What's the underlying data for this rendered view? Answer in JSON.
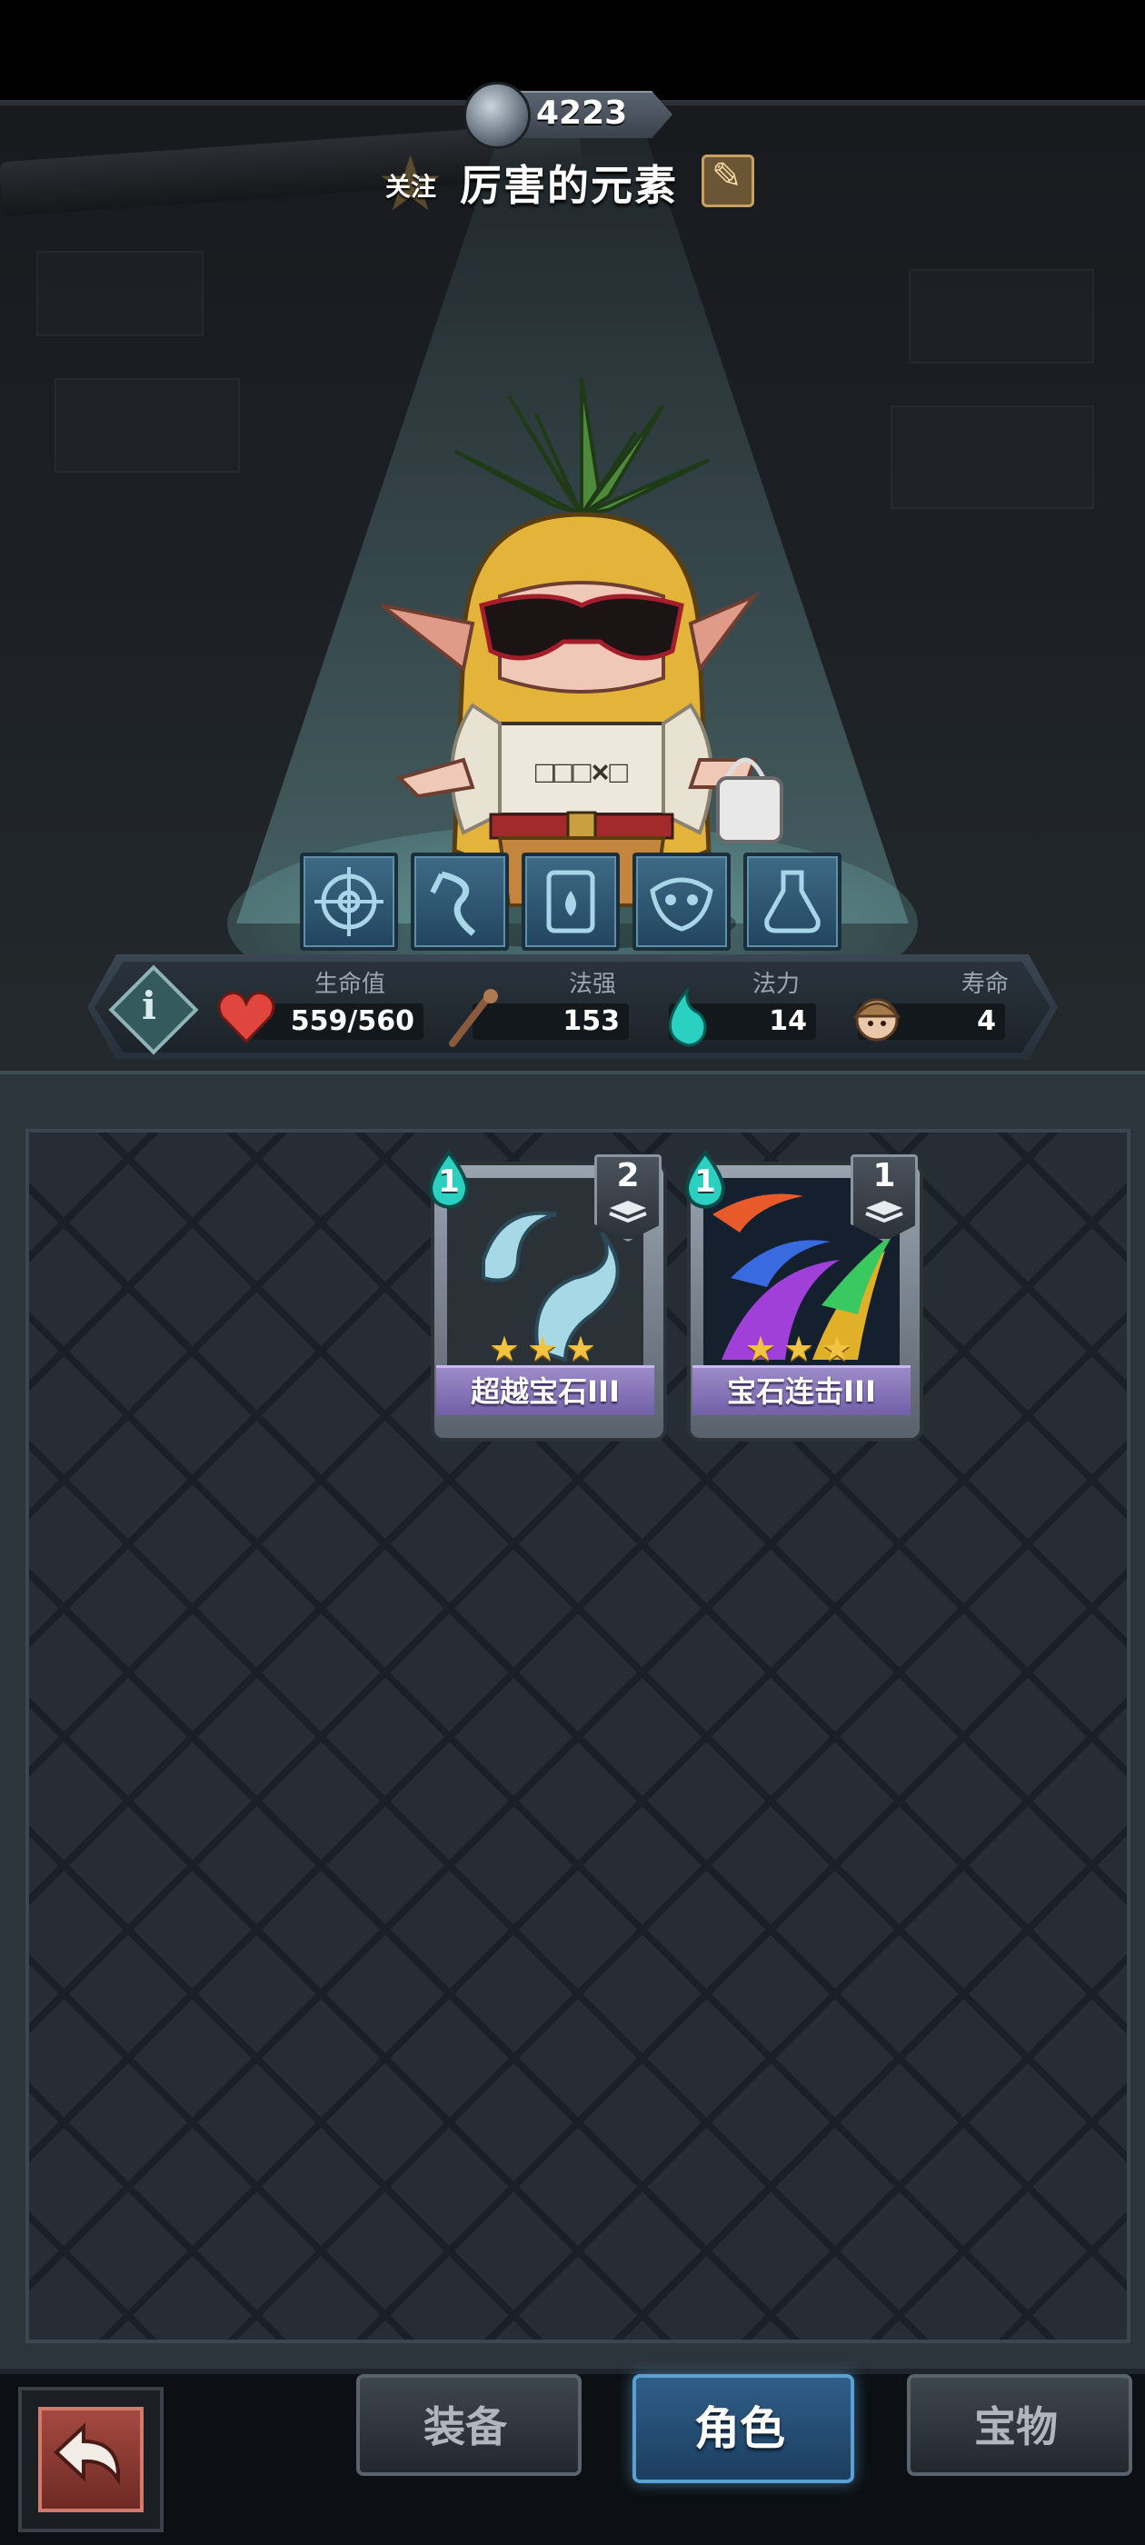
{
  "hero": {
    "power": "4223",
    "follow_label": "关注",
    "name": "厉害的元素"
  },
  "skills": [
    {
      "icon": "target-rune-icon"
    },
    {
      "icon": "claw-rune-icon"
    },
    {
      "icon": "flame-scroll-icon"
    },
    {
      "icon": "demon-mask-icon"
    },
    {
      "icon": "potion-flask-icon"
    }
  ],
  "stats": [
    {
      "label": "生命值",
      "value": "559/560",
      "icon": "heart-icon",
      "color": "#e0453e"
    },
    {
      "label": "法强",
      "value": "153",
      "icon": "staff-icon",
      "color": "#8a5a3c"
    },
    {
      "label": "法力",
      "value": "14",
      "icon": "mana-flame-icon",
      "color": "#44d6c8"
    },
    {
      "label": "寿命",
      "value": "4",
      "icon": "lifespan-face-icon",
      "color": "#a57a4a"
    }
  ],
  "cards": [
    {
      "name": "超越宝石III",
      "cost": "1",
      "stack": "2",
      "stars": 3,
      "art": "crystal-gems-art"
    },
    {
      "name": "宝石连击III",
      "cost": "1",
      "stack": "1",
      "stars": 3,
      "art": "gem-combo-art"
    }
  ],
  "nav": {
    "back_icon": "back-arrow-icon",
    "tabs": [
      {
        "label": "装备",
        "active": false
      },
      {
        "label": "角色",
        "active": true
      },
      {
        "label": "宝物",
        "active": false
      }
    ]
  },
  "colors": {
    "accent_active_tab": "#2f5e88",
    "card_rarity": "#9c8ac8",
    "star": "#f2c341",
    "mana": "#2ad0c0"
  }
}
